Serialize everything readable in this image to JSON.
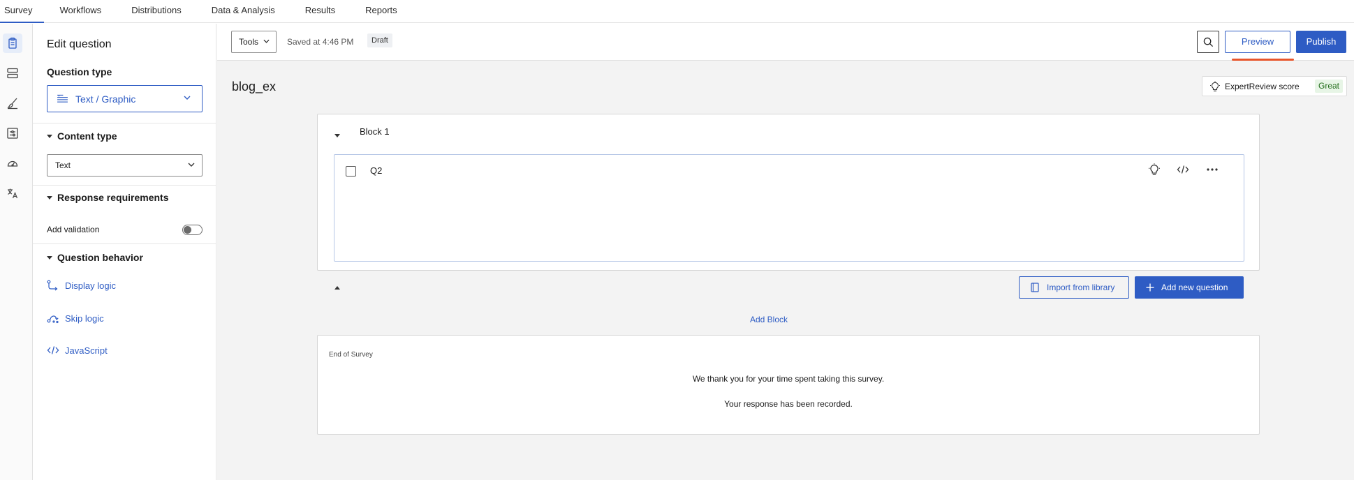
{
  "topnav": {
    "tabs": [
      {
        "label": "Survey",
        "active": true
      },
      {
        "label": "Workflows",
        "active": false
      },
      {
        "label": "Distributions",
        "active": false
      },
      {
        "label": "Data & Analysis",
        "active": false
      },
      {
        "label": "Results",
        "active": false
      },
      {
        "label": "Reports",
        "active": false
      }
    ]
  },
  "rail": {
    "icons": [
      "survey-icon",
      "blocks-icon",
      "look-and-feel-icon",
      "survey-flow-icon",
      "survey-options-icon",
      "translate-icon"
    ]
  },
  "panel": {
    "title": "Edit question",
    "question_type_heading": "Question type",
    "question_type_value": "Text / Graphic",
    "content_type_heading": "Content type",
    "content_type_value": "Text",
    "response_requirements_heading": "Response requirements",
    "add_validation_label": "Add validation",
    "add_validation_on": false,
    "question_behavior_heading": "Question behavior",
    "display_logic": "Display logic",
    "skip_logic": "Skip logic",
    "javascript": "JavaScript"
  },
  "toolbar": {
    "tools_label": "Tools",
    "saved_text": "Saved at 4:46 PM",
    "draft_badge": "Draft",
    "preview_label": "Preview",
    "publish_label": "Publish"
  },
  "survey": {
    "title": "blog_ex",
    "expert_review_label": "ExpertReview score",
    "expert_review_value": "Great"
  },
  "block": {
    "title": "Block 1",
    "question_id": "Q2",
    "import_label": "Import from library",
    "add_question_label": "Add new question"
  },
  "add_block_label": "Add Block",
  "end_of_survey": {
    "label": "End of Survey",
    "line1": "We thank you for your time spent taking this survey.",
    "line2": "Your response has been recorded."
  },
  "colors": {
    "accent": "#2e5cc4",
    "preview_underline": "#e8552b",
    "great_badge_bg": "#e7f5e6",
    "great_badge_text": "#256f1d"
  }
}
